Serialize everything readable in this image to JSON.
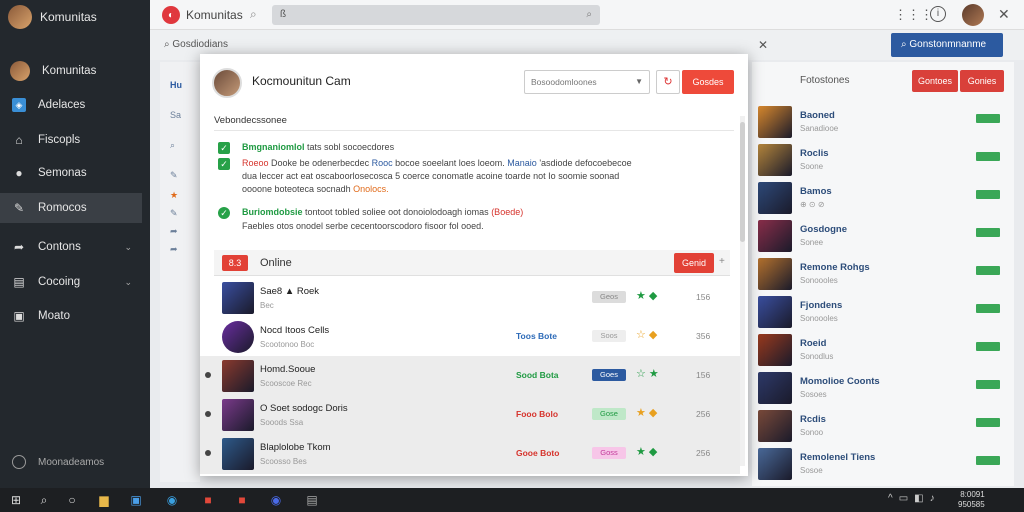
{
  "app": {
    "title": "Komunitas",
    "top_search_text": "ß"
  },
  "sidebar": {
    "brand": "Komunitas",
    "items": [
      {
        "label": "Komunitas",
        "icon": "avatar"
      },
      {
        "label": "Adelaces",
        "icon": "compass-icon"
      },
      {
        "label": "Fiscopls",
        "icon": "home-icon"
      },
      {
        "label": "Semonas",
        "icon": "play-icon"
      },
      {
        "label": "Romocos",
        "icon": "pencil-icon"
      },
      {
        "label": "Contons",
        "icon": "share-icon"
      },
      {
        "label": "Cocoing",
        "icon": "list-icon"
      },
      {
        "label": "Moato",
        "icon": "calendar-icon"
      }
    ],
    "footer": "Moonadeamos"
  },
  "subbar": {
    "text": "Gosdiodians",
    "button": "Gonstonmnanme"
  },
  "right_panel": {
    "title": "Fotostones",
    "btn1": "Gontoes",
    "btn2": "Gonies",
    "rows": [
      {
        "name": "Baoned",
        "sub": "Sanadiooe",
        "color": "#d9892e"
      },
      {
        "name": "Roclis",
        "sub": "Soone",
        "color": "#b5863c"
      },
      {
        "name": "Bamos",
        "sub": "⊕ ⊙ ⊘",
        "color": "#2e4a7a"
      },
      {
        "name": "Gosdogne",
        "sub": "Sonee",
        "color": "#8a2e4a"
      },
      {
        "name": "Remone Rohgs",
        "sub": "Sonoooles",
        "color": "#b5722e"
      },
      {
        "name": "Fjondens",
        "sub": "Sonoooles",
        "color": "#3a4fa0"
      },
      {
        "name": "Roeid",
        "sub": "Sonodlus",
        "color": "#9a3a1e"
      },
      {
        "name": "Momolioe Coonts",
        "sub": "Sosoes",
        "color": "#2e3a6a"
      },
      {
        "name": "Rcdis",
        "sub": "Sonoo",
        "color": "#7a4a3a"
      },
      {
        "name": "Remolenel Tiens",
        "sub": "Sosoe",
        "color": "#4a6a9a"
      }
    ]
  },
  "modal": {
    "title": "Kocmounitun Cam",
    "select_value": "Bosoodomloones",
    "cta": "Gosdes",
    "section_title": "Vebondecssonee",
    "lines": [
      {
        "green": "Bmgnaniomlol",
        "rest": "tats sobl socoecdores"
      },
      {
        "red": "Roeoo",
        "rest1": "Dooke be odenerbecdec",
        "blue": "Rooc",
        "rest2": "bocoe soeelant loes loeom.",
        "blue2": "Manaio",
        "rest3": "'asdiode defocoebecoe"
      },
      {
        "rest": "dua leccer act eat oscaboorlosecosca 5 coerce conomatle acoine toarde not Io soomie soonad"
      },
      {
        "rest": "oooone boteoteca socnadh",
        "orange": "Onolocs."
      }
    ],
    "lines2": [
      {
        "green": "Buriomdobsie",
        "rest": "tontoot tobled soliee oot donoiolodoagh iomas",
        "red": "(Boede)"
      },
      {
        "rest": "Faebles otos onodel serbe cecentoorscodoro fisoor fol ooed."
      }
    ],
    "online": {
      "badge": "8.3",
      "title": "Online",
      "button": "Genid",
      "more": "+",
      "rows": [
        {
          "name": "Sae8 ▲ Roek",
          "sub": "Bec",
          "status": "",
          "status_color": "#1f9a42",
          "pill": "Geos",
          "pill_bg": "#dcdcdc",
          "pill_fg": "#888",
          "num": "156",
          "thumb": "#3a4fa0",
          "icons": "★ ◆",
          "round": false
        },
        {
          "name": "Nocd Itoos Cells",
          "sub": "Scootonoo Boc",
          "status": "Toos Bote",
          "status_color": "#2c6ab8",
          "pill": "Soos",
          "pill_bg": "#eeeeee",
          "pill_fg": "#999",
          "num": "356",
          "thumb": "#6a2ea0",
          "icons": "☆ ◆",
          "round": true
        },
        {
          "name": "Homd.Sooue",
          "sub": "Scooscoe Rec",
          "status": "Sood Bota",
          "status_color": "#1f9a42",
          "pill": "Goes",
          "pill_bg": "#2c5aa0",
          "pill_fg": "#fff",
          "num": "156",
          "thumb": "#8a3a2e",
          "icons": "☆ ★",
          "round": false
        },
        {
          "name": "O Soet sodogc Doris",
          "sub": "Sooods Ssa",
          "status": "Fooo Bolo",
          "status_color": "#d6332c",
          "pill": "Gose",
          "pill_bg": "#bfe8c8",
          "pill_fg": "#1f9a42",
          "num": "256",
          "thumb": "#7a3a8a",
          "icons": "★ ◆",
          "round": false
        },
        {
          "name": "Blaplolobe Tkom",
          "sub": "Scoosso Bes",
          "status": "Gooe Boto",
          "status_color": "#d6332c",
          "pill": "Goss",
          "pill_bg": "#f7c6e8",
          "pill_fg": "#c23a9a",
          "num": "256",
          "thumb": "#2e5a8a",
          "icons": "★ ◆",
          "round": false
        }
      ]
    }
  },
  "taskbar": {
    "clock_time": "8:0091",
    "clock_date": "950585"
  }
}
